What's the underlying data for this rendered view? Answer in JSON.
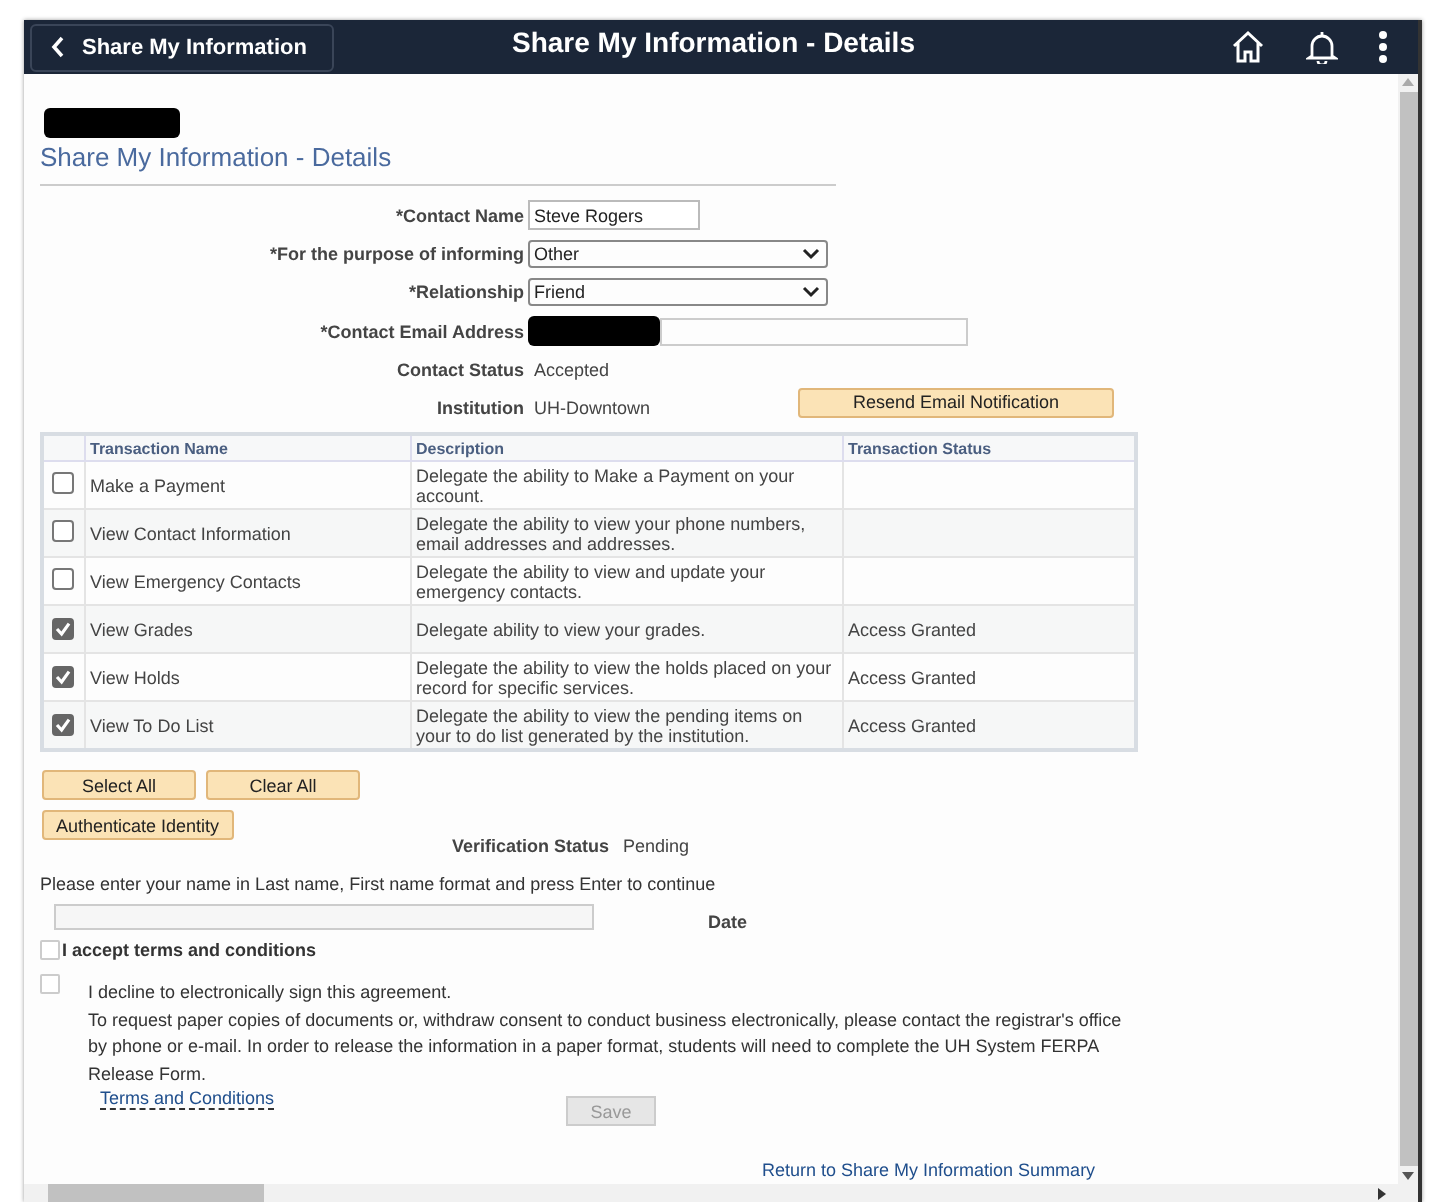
{
  "header": {
    "back_label": "Share My Information",
    "title": "Share My Information - Details"
  },
  "page_title": "Share My Information - Details",
  "fields": [
    {
      "kind": "text",
      "label": "*Contact Name",
      "value": "Steve Rogers"
    },
    {
      "kind": "select",
      "label": "*For the purpose of informing",
      "value": "Other"
    },
    {
      "kind": "select",
      "label": "*Relationship",
      "value": "Friend"
    },
    {
      "kind": "redacted",
      "label": "*Contact Email Address"
    },
    {
      "kind": "static",
      "label": "Contact Status",
      "value": "Accepted"
    },
    {
      "kind": "static",
      "label": "Institution",
      "value": "UH-Downtown"
    }
  ],
  "resend_button": "Resend Email Notification",
  "table": {
    "columns": [
      "Transaction Name",
      "Description",
      "Transaction Status"
    ],
    "rows": [
      {
        "checked": false,
        "name": "Make a Payment",
        "description": "Delegate the ability to Make a Payment on your account."
      },
      {
        "checked": false,
        "name": "View Contact Information",
        "description": "Delegate the ability to view your phone numbers, email addresses and addresses."
      },
      {
        "checked": false,
        "name": "View Emergency Contacts",
        "description": "Delegate the ability to view and update your emergency contacts."
      },
      {
        "checked": true,
        "name": "View Grades",
        "description": "Delegate ability to view your grades.",
        "status": "Access Granted"
      },
      {
        "checked": true,
        "name": "View Holds",
        "description": "Delegate the ability to view the holds placed on your record for specific services.",
        "status": "Access Granted"
      },
      {
        "checked": true,
        "name": "View To Do List",
        "description": "Delegate the ability to view the pending items on your to do list generated by the institution.",
        "status": "Access Granted"
      }
    ]
  },
  "select_buttons": [
    "Select All",
    "Clear All"
  ],
  "authenticate_button": "Authenticate Identity",
  "verification": {
    "label": "Verification Status",
    "value": "Pending"
  },
  "name_prompt": "Please enter your name in Last name, First name format and press Enter to continue",
  "date_label": "Date",
  "accept": {
    "label": "I accept terms and conditions",
    "checked": false
  },
  "decline": {
    "checked": false,
    "lines": [
      "I decline to electronically sign this agreement.",
      "To request paper copies of documents or, withdraw consent to conduct business electronically, please contact the registrar's office by phone or e-mail. In order to release the information in a paper format, students will need to complete the UH System FERPA Release Form."
    ]
  },
  "terms_link": "Terms and Conditions",
  "save_button": {
    "label": "Save",
    "disabled": true
  },
  "return_link": "Return to Share My Information Summary"
}
